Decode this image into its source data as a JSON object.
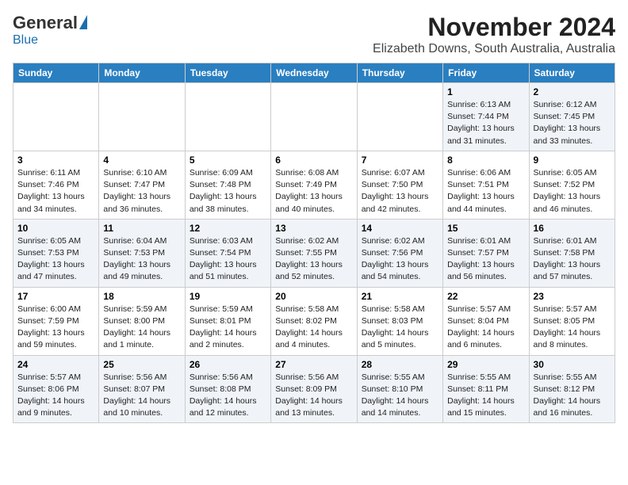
{
  "header": {
    "logo_general": "General",
    "logo_blue": "Blue",
    "title": "November 2024",
    "subtitle": "Elizabeth Downs, South Australia, Australia"
  },
  "weekdays": [
    "Sunday",
    "Monday",
    "Tuesday",
    "Wednesday",
    "Thursday",
    "Friday",
    "Saturday"
  ],
  "weeks": [
    [
      {
        "day": "",
        "info": ""
      },
      {
        "day": "",
        "info": ""
      },
      {
        "day": "",
        "info": ""
      },
      {
        "day": "",
        "info": ""
      },
      {
        "day": "",
        "info": ""
      },
      {
        "day": "1",
        "info": "Sunrise: 6:13 AM\nSunset: 7:44 PM\nDaylight: 13 hours\nand 31 minutes."
      },
      {
        "day": "2",
        "info": "Sunrise: 6:12 AM\nSunset: 7:45 PM\nDaylight: 13 hours\nand 33 minutes."
      }
    ],
    [
      {
        "day": "3",
        "info": "Sunrise: 6:11 AM\nSunset: 7:46 PM\nDaylight: 13 hours\nand 34 minutes."
      },
      {
        "day": "4",
        "info": "Sunrise: 6:10 AM\nSunset: 7:47 PM\nDaylight: 13 hours\nand 36 minutes."
      },
      {
        "day": "5",
        "info": "Sunrise: 6:09 AM\nSunset: 7:48 PM\nDaylight: 13 hours\nand 38 minutes."
      },
      {
        "day": "6",
        "info": "Sunrise: 6:08 AM\nSunset: 7:49 PM\nDaylight: 13 hours\nand 40 minutes."
      },
      {
        "day": "7",
        "info": "Sunrise: 6:07 AM\nSunset: 7:50 PM\nDaylight: 13 hours\nand 42 minutes."
      },
      {
        "day": "8",
        "info": "Sunrise: 6:06 AM\nSunset: 7:51 PM\nDaylight: 13 hours\nand 44 minutes."
      },
      {
        "day": "9",
        "info": "Sunrise: 6:05 AM\nSunset: 7:52 PM\nDaylight: 13 hours\nand 46 minutes."
      }
    ],
    [
      {
        "day": "10",
        "info": "Sunrise: 6:05 AM\nSunset: 7:53 PM\nDaylight: 13 hours\nand 47 minutes."
      },
      {
        "day": "11",
        "info": "Sunrise: 6:04 AM\nSunset: 7:53 PM\nDaylight: 13 hours\nand 49 minutes."
      },
      {
        "day": "12",
        "info": "Sunrise: 6:03 AM\nSunset: 7:54 PM\nDaylight: 13 hours\nand 51 minutes."
      },
      {
        "day": "13",
        "info": "Sunrise: 6:02 AM\nSunset: 7:55 PM\nDaylight: 13 hours\nand 52 minutes."
      },
      {
        "day": "14",
        "info": "Sunrise: 6:02 AM\nSunset: 7:56 PM\nDaylight: 13 hours\nand 54 minutes."
      },
      {
        "day": "15",
        "info": "Sunrise: 6:01 AM\nSunset: 7:57 PM\nDaylight: 13 hours\nand 56 minutes."
      },
      {
        "day": "16",
        "info": "Sunrise: 6:01 AM\nSunset: 7:58 PM\nDaylight: 13 hours\nand 57 minutes."
      }
    ],
    [
      {
        "day": "17",
        "info": "Sunrise: 6:00 AM\nSunset: 7:59 PM\nDaylight: 13 hours\nand 59 minutes."
      },
      {
        "day": "18",
        "info": "Sunrise: 5:59 AM\nSunset: 8:00 PM\nDaylight: 14 hours\nand 1 minute."
      },
      {
        "day": "19",
        "info": "Sunrise: 5:59 AM\nSunset: 8:01 PM\nDaylight: 14 hours\nand 2 minutes."
      },
      {
        "day": "20",
        "info": "Sunrise: 5:58 AM\nSunset: 8:02 PM\nDaylight: 14 hours\nand 4 minutes."
      },
      {
        "day": "21",
        "info": "Sunrise: 5:58 AM\nSunset: 8:03 PM\nDaylight: 14 hours\nand 5 minutes."
      },
      {
        "day": "22",
        "info": "Sunrise: 5:57 AM\nSunset: 8:04 PM\nDaylight: 14 hours\nand 6 minutes."
      },
      {
        "day": "23",
        "info": "Sunrise: 5:57 AM\nSunset: 8:05 PM\nDaylight: 14 hours\nand 8 minutes."
      }
    ],
    [
      {
        "day": "24",
        "info": "Sunrise: 5:57 AM\nSunset: 8:06 PM\nDaylight: 14 hours\nand 9 minutes."
      },
      {
        "day": "25",
        "info": "Sunrise: 5:56 AM\nSunset: 8:07 PM\nDaylight: 14 hours\nand 10 minutes."
      },
      {
        "day": "26",
        "info": "Sunrise: 5:56 AM\nSunset: 8:08 PM\nDaylight: 14 hours\nand 12 minutes."
      },
      {
        "day": "27",
        "info": "Sunrise: 5:56 AM\nSunset: 8:09 PM\nDaylight: 14 hours\nand 13 minutes."
      },
      {
        "day": "28",
        "info": "Sunrise: 5:55 AM\nSunset: 8:10 PM\nDaylight: 14 hours\nand 14 minutes."
      },
      {
        "day": "29",
        "info": "Sunrise: 5:55 AM\nSunset: 8:11 PM\nDaylight: 14 hours\nand 15 minutes."
      },
      {
        "day": "30",
        "info": "Sunrise: 5:55 AM\nSunset: 8:12 PM\nDaylight: 14 hours\nand 16 minutes."
      }
    ]
  ]
}
